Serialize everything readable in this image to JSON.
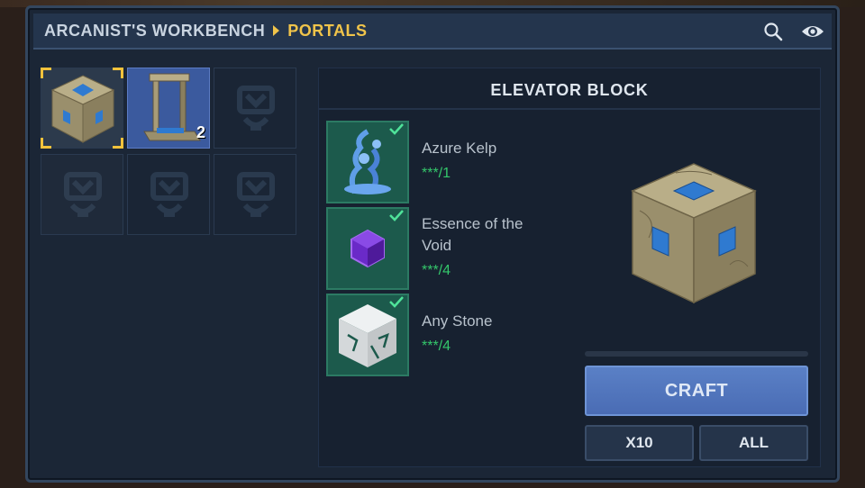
{
  "header": {
    "breadcrumb_root": "ARCANIST'S WORKBENCH",
    "breadcrumb_current": "PORTALS",
    "search_icon": "search-icon",
    "visibility_icon": "eye-icon"
  },
  "recipe_grid": {
    "slots": [
      {
        "item": "elevator-block",
        "state": "selected"
      },
      {
        "item": "portal-frame",
        "state": "active",
        "count": "2"
      },
      {
        "item": "",
        "state": "empty"
      },
      {
        "item": "",
        "state": "empty"
      },
      {
        "item": "",
        "state": "empty"
      },
      {
        "item": "",
        "state": "empty"
      }
    ]
  },
  "detail": {
    "title": "ELEVATOR BLOCK",
    "ingredients": [
      {
        "name": "Azure Kelp",
        "count": "***/1",
        "icon": "azure-kelp-icon"
      },
      {
        "name": "Essence of the Void",
        "name_line1": "Essence of the",
        "name_line2": "Void",
        "count": "***/4",
        "icon": "void-essence-icon"
      },
      {
        "name": "Any Stone",
        "count": "***/4",
        "icon": "stone-icon"
      }
    ],
    "craft_label": "CRAFT",
    "x10_label": "X10",
    "all_label": "ALL"
  },
  "colors": {
    "accent_gold": "#f0c44a",
    "craft_blue": "#4a6cb4",
    "ingredient_green": "#34c76b"
  }
}
